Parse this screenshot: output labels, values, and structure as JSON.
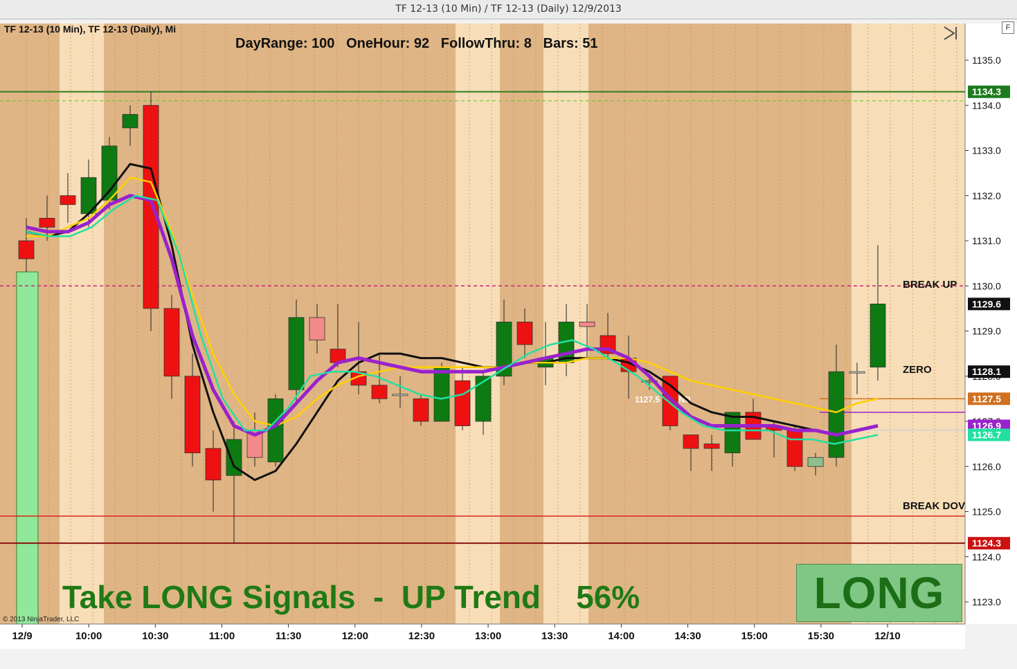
{
  "window": {
    "title": "TF 12-13 (10 Min) / TF 12-13 (Daily)  12/9/2013"
  },
  "chart": {
    "caption": "TF 12-13 (10 Min), TF 12-13 (Daily), Mi",
    "stats": "DayRange: 100   OneHour: 92   FollowThru: 8   Bars: 51",
    "signal_text": "Take LONG Signals  -  UP Trend    56%",
    "long_label": "LONG",
    "copyright": "© 2013 NinjaTrader, LLC",
    "f_button": "F",
    "scroll_end_icon": "scroll-to-end-icon",
    "trend_label": "1127.5 TREND",
    "break_up_label": "BREAK UP",
    "zero_label": "ZERO",
    "break_down_label": "BREAK DOV"
  },
  "colors": {
    "bg_dark": "#dfb585",
    "bg_light": "#f7deb8",
    "up": "#0d7a12",
    "down": "#ee1111",
    "down_light": "#f28a8a",
    "up_light": "#8fbf8f",
    "black_ma": "#111111",
    "yellow_ma": "#ffd000",
    "purple_ma": "#9922cc",
    "teal_ma": "#22e0a0"
  },
  "chart_data": {
    "type": "candlestick",
    "instrument": "TF 12-13",
    "interval": "10 Min",
    "y_ticks": [
      1123.0,
      1124.0,
      1125.0,
      1126.0,
      1127.0,
      1128.0,
      1129.0,
      1130.0,
      1131.0,
      1132.0,
      1133.0,
      1134.0,
      1135.0
    ],
    "x_ticks": [
      "12/9",
      "10:00",
      "10:30",
      "11:00",
      "11:30",
      "12:00",
      "12:30",
      "13:00",
      "13:30",
      "14:00",
      "14:30",
      "15:00",
      "15:30",
      "12/10"
    ],
    "price_markers": [
      {
        "label": "1134.3",
        "value": 1134.3,
        "color": "#1d7a1d"
      },
      {
        "label": "1129.6",
        "value": 1129.6,
        "color": "#111111"
      },
      {
        "label": "1128.1",
        "value": 1128.1,
        "color": "#111111"
      },
      {
        "label": "1127.5",
        "value": 1127.5,
        "color": "#d07020"
      },
      {
        "label": "1126.9",
        "value": 1126.9,
        "color": "#9922cc"
      },
      {
        "label": "1126.7",
        "value": 1126.7,
        "color": "#22e0a0"
      },
      {
        "label": "1124.3",
        "value": 1124.3,
        "color": "#cc1111"
      }
    ],
    "levels": [
      {
        "name": "high",
        "value": 1134.3
      },
      {
        "name": "break_up",
        "value": 1130.0
      },
      {
        "name": "trend",
        "value": 1127.5
      },
      {
        "name": "break_down",
        "value": 1124.9
      },
      {
        "name": "low",
        "value": 1124.3
      }
    ],
    "candles": [
      {
        "o": 1131.0,
        "h": 1131.5,
        "l": 1130.3,
        "c": 1130.6,
        "dir": "down"
      },
      {
        "o": 1131.5,
        "h": 1132.0,
        "l": 1131.0,
        "c": 1131.3,
        "dir": "down"
      },
      {
        "o": 1132.0,
        "h": 1132.5,
        "l": 1131.4,
        "c": 1131.8,
        "dir": "down"
      },
      {
        "o": 1131.6,
        "h": 1132.8,
        "l": 1131.3,
        "c": 1132.4,
        "dir": "up"
      },
      {
        "o": 1131.9,
        "h": 1133.3,
        "l": 1131.7,
        "c": 1133.1,
        "dir": "up"
      },
      {
        "o": 1133.5,
        "h": 1134.0,
        "l": 1133.1,
        "c": 1133.8,
        "dir": "up"
      },
      {
        "o": 1134.0,
        "h": 1134.3,
        "l": 1129.0,
        "c": 1129.5,
        "dir": "down"
      },
      {
        "o": 1129.5,
        "h": 1129.8,
        "l": 1127.5,
        "c": 1128.0,
        "dir": "down"
      },
      {
        "o": 1128.0,
        "h": 1128.5,
        "l": 1126.0,
        "c": 1126.3,
        "dir": "down"
      },
      {
        "o": 1126.4,
        "h": 1126.8,
        "l": 1125.0,
        "c": 1125.7,
        "dir": "down"
      },
      {
        "o": 1125.8,
        "h": 1127.0,
        "l": 1124.3,
        "c": 1126.6,
        "dir": "up"
      },
      {
        "o": 1126.2,
        "h": 1127.2,
        "l": 1126.0,
        "c": 1126.8,
        "dir": "downl"
      },
      {
        "o": 1126.1,
        "h": 1127.6,
        "l": 1126.0,
        "c": 1127.5,
        "dir": "up"
      },
      {
        "o": 1127.7,
        "h": 1129.7,
        "l": 1127.4,
        "c": 1129.3,
        "dir": "up"
      },
      {
        "o": 1129.3,
        "h": 1129.6,
        "l": 1128.5,
        "c": 1128.8,
        "dir": "downl"
      },
      {
        "o": 1128.6,
        "h": 1129.6,
        "l": 1128.2,
        "c": 1128.3,
        "dir": "down"
      },
      {
        "o": 1128.1,
        "h": 1129.2,
        "l": 1127.6,
        "c": 1127.8,
        "dir": "down"
      },
      {
        "o": 1127.8,
        "h": 1128.5,
        "l": 1127.4,
        "c": 1127.5,
        "dir": "down"
      },
      {
        "o": 1127.6,
        "h": 1128.0,
        "l": 1127.3,
        "c": 1127.6,
        "dir": "flat"
      },
      {
        "o": 1127.5,
        "h": 1127.6,
        "l": 1126.9,
        "c": 1127.0,
        "dir": "down"
      },
      {
        "o": 1127.0,
        "h": 1128.3,
        "l": 1127.0,
        "c": 1128.2,
        "dir": "up"
      },
      {
        "o": 1127.9,
        "h": 1128.2,
        "l": 1126.8,
        "c": 1126.9,
        "dir": "down"
      },
      {
        "o": 1127.0,
        "h": 1128.1,
        "l": 1126.7,
        "c": 1128.0,
        "dir": "up"
      },
      {
        "o": 1128.0,
        "h": 1129.7,
        "l": 1127.8,
        "c": 1129.2,
        "dir": "up"
      },
      {
        "o": 1129.2,
        "h": 1129.5,
        "l": 1128.4,
        "c": 1128.7,
        "dir": "down"
      },
      {
        "o": 1128.2,
        "h": 1129.2,
        "l": 1127.8,
        "c": 1128.4,
        "dir": "up"
      },
      {
        "o": 1128.3,
        "h": 1129.6,
        "l": 1128.0,
        "c": 1129.2,
        "dir": "up"
      },
      {
        "o": 1129.2,
        "h": 1129.6,
        "l": 1128.4,
        "c": 1129.1,
        "dir": "downl"
      },
      {
        "o": 1128.9,
        "h": 1129.4,
        "l": 1128.4,
        "c": 1128.5,
        "dir": "down"
      },
      {
        "o": 1128.4,
        "h": 1128.9,
        "l": 1127.5,
        "c": 1128.1,
        "dir": "down"
      },
      {
        "o": 1127.9,
        "h": 1128.0,
        "l": 1127.7,
        "c": 1127.9,
        "dir": "upl"
      },
      {
        "o": 1128.0,
        "h": 1128.0,
        "l": 1126.8,
        "c": 1126.9,
        "dir": "down"
      },
      {
        "o": 1126.7,
        "h": 1126.7,
        "l": 1125.9,
        "c": 1126.4,
        "dir": "down"
      },
      {
        "o": 1126.5,
        "h": 1126.7,
        "l": 1125.9,
        "c": 1126.4,
        "dir": "down"
      },
      {
        "o": 1126.3,
        "h": 1127.2,
        "l": 1126.0,
        "c": 1127.2,
        "dir": "up"
      },
      {
        "o": 1127.2,
        "h": 1127.5,
        "l": 1126.6,
        "c": 1126.6,
        "dir": "down"
      },
      {
        "o": 1126.8,
        "h": 1127.0,
        "l": 1126.2,
        "c": 1126.9,
        "dir": "down"
      },
      {
        "o": 1126.8,
        "h": 1126.9,
        "l": 1125.9,
        "c": 1126.0,
        "dir": "down"
      },
      {
        "o": 1126.0,
        "h": 1126.3,
        "l": 1125.8,
        "c": 1126.2,
        "dir": "upl"
      },
      {
        "o": 1126.2,
        "h": 1128.7,
        "l": 1126.0,
        "c": 1128.1,
        "dir": "up"
      },
      {
        "o": 1128.1,
        "h": 1128.3,
        "l": 1127.6,
        "c": 1128.1,
        "dir": "flat"
      },
      {
        "o": 1128.2,
        "h": 1130.9,
        "l": 1127.9,
        "c": 1129.6,
        "dir": "up"
      }
    ],
    "moving_averages": [
      {
        "color": "black",
        "values": [
          1131.2,
          1131.1,
          1131.2,
          1131.6,
          1132.1,
          1132.7,
          1132.6,
          1130.9,
          1128.7,
          1127.2,
          1126.0,
          1125.7,
          1125.9,
          1126.5,
          1127.2,
          1127.9,
          1128.3,
          1128.5,
          1128.5,
          1128.4,
          1128.4,
          1128.3,
          1128.2,
          1128.2,
          1128.3,
          1128.3,
          1128.4,
          1128.4,
          1128.4,
          1128.3,
          1128.1,
          1127.8,
          1127.4,
          1127.2,
          1127.1,
          1127.1,
          1127.0,
          1126.9,
          1126.8,
          1126.7,
          1126.8,
          1126.9
        ]
      },
      {
        "color": "yellow",
        "values": [
          1131.1,
          1131.1,
          1131.3,
          1131.5,
          1131.9,
          1132.4,
          1132.3,
          1131.2,
          1129.8,
          1128.5,
          1127.6,
          1127.0,
          1126.9,
          1127.1,
          1127.5,
          1127.8,
          1128.0,
          1128.1,
          1128.2,
          1128.2,
          1128.2,
          1128.2,
          1128.2,
          1128.2,
          1128.3,
          1128.3,
          1128.3,
          1128.4,
          1128.4,
          1128.4,
          1128.3,
          1128.1,
          1127.9,
          1127.8,
          1127.7,
          1127.6,
          1127.5,
          1127.4,
          1127.3,
          1127.2,
          1127.4,
          1127.5
        ]
      },
      {
        "color": "purple",
        "values": [
          1131.3,
          1131.2,
          1131.2,
          1131.4,
          1131.8,
          1132.0,
          1131.9,
          1130.6,
          1128.9,
          1127.7,
          1126.9,
          1126.7,
          1126.9,
          1127.4,
          1127.9,
          1128.3,
          1128.4,
          1128.3,
          1128.2,
          1128.1,
          1128.1,
          1128.1,
          1128.1,
          1128.2,
          1128.3,
          1128.4,
          1128.5,
          1128.6,
          1128.6,
          1128.4,
          1128.0,
          1127.5,
          1127.1,
          1126.9,
          1126.9,
          1126.9,
          1126.9,
          1126.8,
          1126.8,
          1126.7,
          1126.8,
          1126.9
        ]
      },
      {
        "color": "teal",
        "values": [
          1131.2,
          1131.1,
          1131.1,
          1131.3,
          1131.7,
          1132.0,
          1131.9,
          1130.7,
          1128.9,
          1127.5,
          1126.8,
          1126.8,
          1127.3,
          1128.0,
          1128.1,
          1128.1,
          1128.0,
          1127.8,
          1127.6,
          1127.5,
          1127.6,
          1127.9,
          1128.2,
          1128.5,
          1128.7,
          1128.8,
          1128.6,
          1128.3,
          1128.0,
          1127.6,
          1127.2,
          1126.9,
          1126.8,
          1126.8,
          1126.8,
          1126.6,
          1126.6,
          1126.5,
          1126.6,
          1126.7
        ]
      }
    ]
  }
}
